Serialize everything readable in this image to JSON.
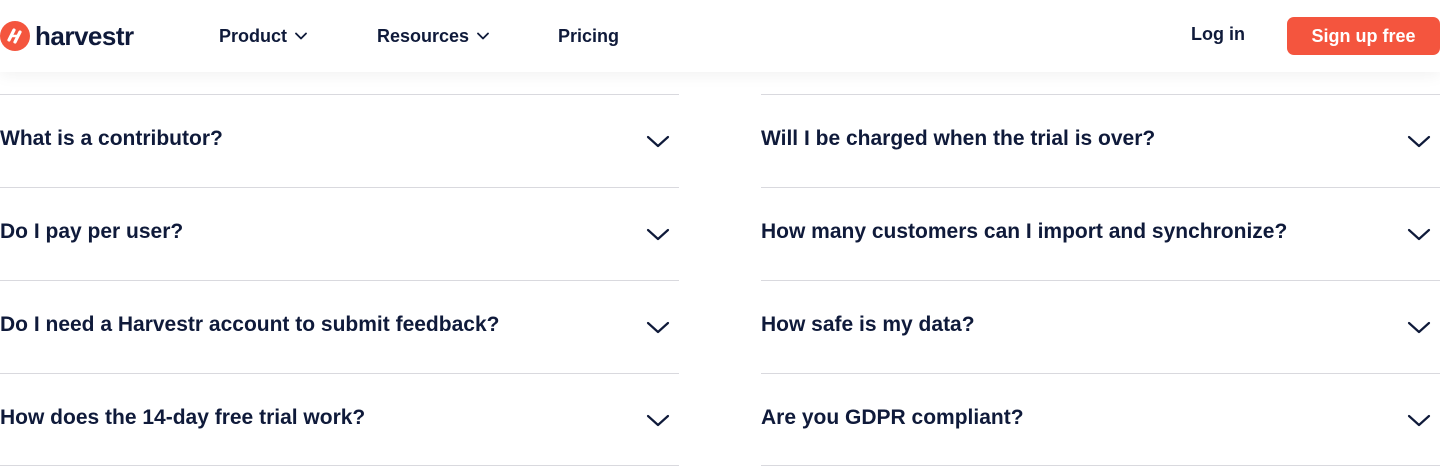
{
  "brand": {
    "name": "harvestr",
    "accent": "#f4553e",
    "text_color": "#0f1a3a"
  },
  "nav": {
    "items": [
      {
        "label": "Product",
        "has_dropdown": true,
        "icon": "chevron-down-icon"
      },
      {
        "label": "Resources",
        "has_dropdown": true,
        "icon": "chevron-down-icon"
      },
      {
        "label": "Pricing",
        "has_dropdown": false
      }
    ],
    "login_label": "Log in",
    "signup_label": "Sign up free"
  },
  "faq": {
    "left": [
      {
        "question": "What is a contributor?"
      },
      {
        "question": "Do I pay per user?"
      },
      {
        "question": "Do I need a Harvestr account to submit feedback?"
      },
      {
        "question": "How does the 14-day free trial work?"
      }
    ],
    "right": [
      {
        "question": "Will I be charged when the trial is over?"
      },
      {
        "question": "How many customers can I import and synchronize?"
      },
      {
        "question": "How safe is my data?"
      },
      {
        "question": "Are you GDPR compliant?"
      }
    ],
    "expand_icon": "chevron-down-icon"
  }
}
